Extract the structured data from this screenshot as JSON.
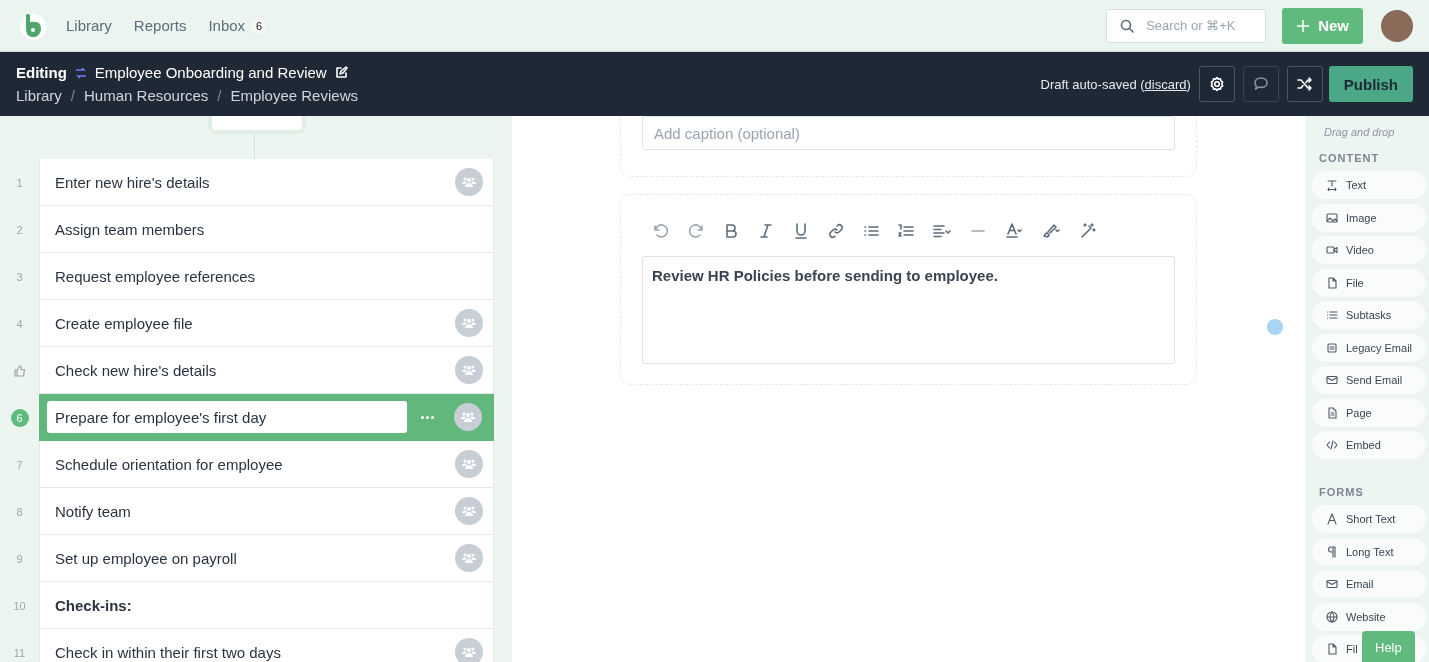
{
  "nav": {
    "links": [
      {
        "label": "Library"
      },
      {
        "label": "Reports"
      },
      {
        "label": "Inbox",
        "badge": "6"
      }
    ],
    "search": {
      "placeholder": "Search or ⌘+K"
    },
    "new_button": "New"
  },
  "edit_bar": {
    "mode": "Editing",
    "title": "Employee Onboarding and Review",
    "separator": "/",
    "breadcrumb": [
      "Library",
      "Human Resources",
      "Employee Reviews"
    ],
    "status_before": "Draft auto-saved (",
    "status_link": "discard",
    "status_after": ")",
    "publish": "Publish"
  },
  "steps": [
    {
      "kind": "task",
      "number": "1",
      "label": "Enter new hire's details",
      "assigned": true,
      "selected": false
    },
    {
      "kind": "task",
      "number": "2",
      "label": "Assign team members",
      "assigned": false,
      "selected": false
    },
    {
      "kind": "task",
      "number": "3",
      "label": "Request employee references",
      "assigned": false,
      "selected": false
    },
    {
      "kind": "task",
      "number": "4",
      "label": "Create employee file",
      "assigned": true,
      "selected": false
    },
    {
      "kind": "approval",
      "label": "Check new hire's details",
      "assigned": true,
      "selected": false
    },
    {
      "kind": "task",
      "number": "6",
      "label": "Prepare for employee's first day",
      "assigned": true,
      "selected": true
    },
    {
      "kind": "task",
      "number": "7",
      "label": "Schedule orientation for employee",
      "assigned": true,
      "selected": false
    },
    {
      "kind": "task",
      "number": "8",
      "label": "Notify team",
      "assigned": true,
      "selected": false
    },
    {
      "kind": "task",
      "number": "9",
      "label": "Set up employee on payroll",
      "assigned": true,
      "selected": false
    },
    {
      "kind": "heading",
      "number": "10",
      "label": "Check-ins:",
      "assigned": false,
      "selected": false
    },
    {
      "kind": "task",
      "number": "11",
      "label": "Check in within their first two days",
      "assigned": true,
      "selected": false
    }
  ],
  "editor": {
    "caption_placeholder": "Add caption (optional)",
    "text": "Review HR Policies before sending to employee."
  },
  "sidebar": {
    "hint": "Drag and drop",
    "sections": [
      {
        "title": "CONTENT",
        "items": [
          {
            "kind": "text",
            "label": "Text"
          },
          {
            "kind": "image",
            "label": "Image"
          },
          {
            "kind": "video",
            "label": "Video"
          },
          {
            "kind": "file",
            "label": "File"
          },
          {
            "kind": "subtasks",
            "label": "Subtasks"
          },
          {
            "kind": "legacy-email",
            "label": "Legacy Email"
          },
          {
            "kind": "email",
            "label": "Send Email"
          },
          {
            "kind": "page",
            "label": "Page"
          },
          {
            "kind": "embed",
            "label": "Embed"
          }
        ]
      },
      {
        "title": "FORMS",
        "items": [
          {
            "kind": "short-text",
            "label": "Short Text"
          },
          {
            "kind": "long-text",
            "label": "Long Text"
          },
          {
            "kind": "email",
            "label": "Email"
          },
          {
            "kind": "website",
            "label": "Website"
          },
          {
            "kind": "file",
            "label": "Fil"
          }
        ]
      }
    ]
  },
  "help": "Help"
}
